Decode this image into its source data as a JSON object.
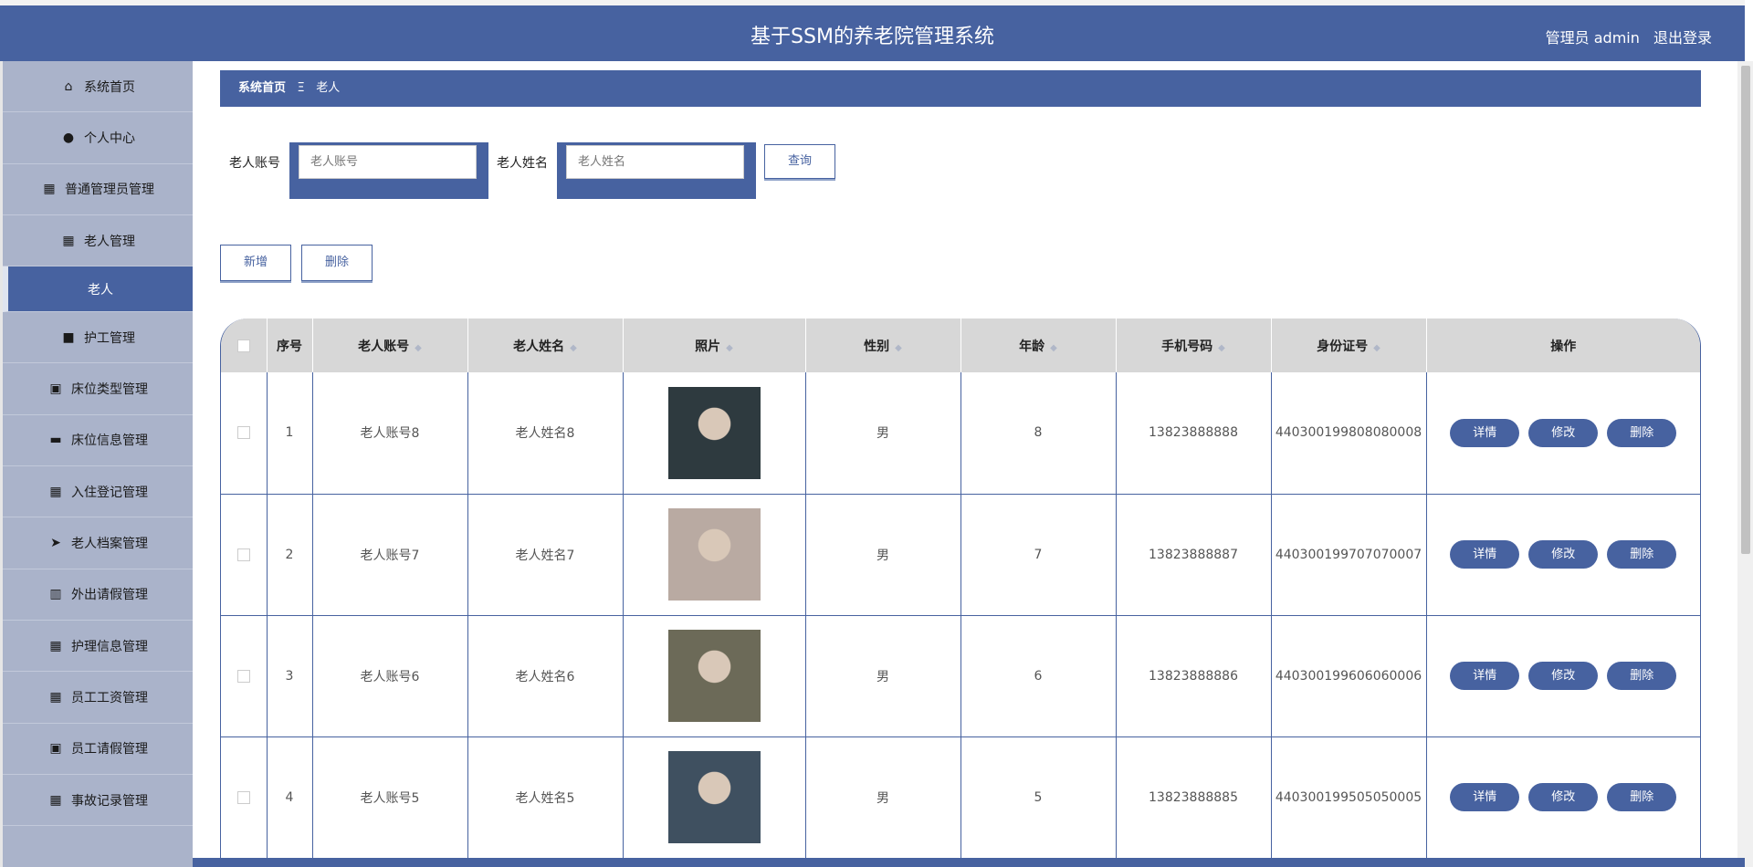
{
  "header": {
    "title": "基于SSM的养老院管理系统",
    "user_label": "管理员 admin",
    "logout_label": "退出登录"
  },
  "sidebar": {
    "items": [
      {
        "label": "系统首页",
        "icon": "home-icon",
        "glyph": "⌂"
      },
      {
        "label": "个人中心",
        "icon": "user-icon",
        "glyph": "●"
      },
      {
        "label": "普通管理员管理",
        "icon": "grid-icon",
        "glyph": "▦"
      },
      {
        "label": "老人管理",
        "icon": "grid-icon",
        "glyph": "▦"
      },
      {
        "label": "老人",
        "icon": "",
        "glyph": "",
        "active": true
      },
      {
        "label": "护工管理",
        "icon": "briefcase-icon",
        "glyph": "■"
      },
      {
        "label": "床位类型管理",
        "icon": "clipboard-icon",
        "glyph": "▣"
      },
      {
        "label": "床位信息管理",
        "icon": "book-icon",
        "glyph": "▬"
      },
      {
        "label": "入住登记管理",
        "icon": "grid-icon",
        "glyph": "▦"
      },
      {
        "label": "老人档案管理",
        "icon": "paper-plane-icon",
        "glyph": "➤"
      },
      {
        "label": "外出请假管理",
        "icon": "library-icon",
        "glyph": "▥"
      },
      {
        "label": "护理信息管理",
        "icon": "grid-icon",
        "glyph": "▦"
      },
      {
        "label": "员工工资管理",
        "icon": "grid-icon",
        "glyph": "▦"
      },
      {
        "label": "员工请假管理",
        "icon": "clipboard-x-icon",
        "glyph": "▣"
      },
      {
        "label": "事故记录管理",
        "icon": "grid-icon",
        "glyph": "▦"
      }
    ]
  },
  "breadcrumb": {
    "home": "系统首页",
    "separator": "Ξ",
    "current": "老人"
  },
  "search": {
    "account_label": "老人账号",
    "account_placeholder": "老人账号",
    "name_label": "老人姓名",
    "name_placeholder": "老人姓名",
    "query_button": "查询"
  },
  "actions": {
    "add_button": "新增",
    "delete_button": "删除"
  },
  "table": {
    "headers": [
      "序号",
      "老人账号",
      "老人姓名",
      "照片",
      "性别",
      "年龄",
      "手机号码",
      "身份证号",
      "操作"
    ],
    "row_buttons": {
      "detail": "详情",
      "edit": "修改",
      "delete": "删除"
    },
    "rows": [
      {
        "index": "1",
        "account": "老人账号8",
        "name": "老人姓名8",
        "gender": "男",
        "age": "8",
        "phone": "13823888888",
        "id_card": "440300199808080008",
        "photo_color": "#2e3a3f"
      },
      {
        "index": "2",
        "account": "老人账号7",
        "name": "老人姓名7",
        "gender": "男",
        "age": "7",
        "phone": "13823888887",
        "id_card": "440300199707070007",
        "photo_color": "#b9aaa2"
      },
      {
        "index": "3",
        "account": "老人账号6",
        "name": "老人姓名6",
        "gender": "男",
        "age": "6",
        "phone": "13823888886",
        "id_card": "440300199606060006",
        "photo_color": "#6c6a58"
      },
      {
        "index": "4",
        "account": "老人账号5",
        "name": "老人姓名5",
        "gender": "男",
        "age": "5",
        "phone": "13823888885",
        "id_card": "440300199505050005",
        "photo_color": "#3f5060"
      }
    ]
  },
  "colors": {
    "primary": "#4762a0",
    "sidebar_bg": "#aab3ca",
    "header_row_bg": "#d7d7d7"
  }
}
